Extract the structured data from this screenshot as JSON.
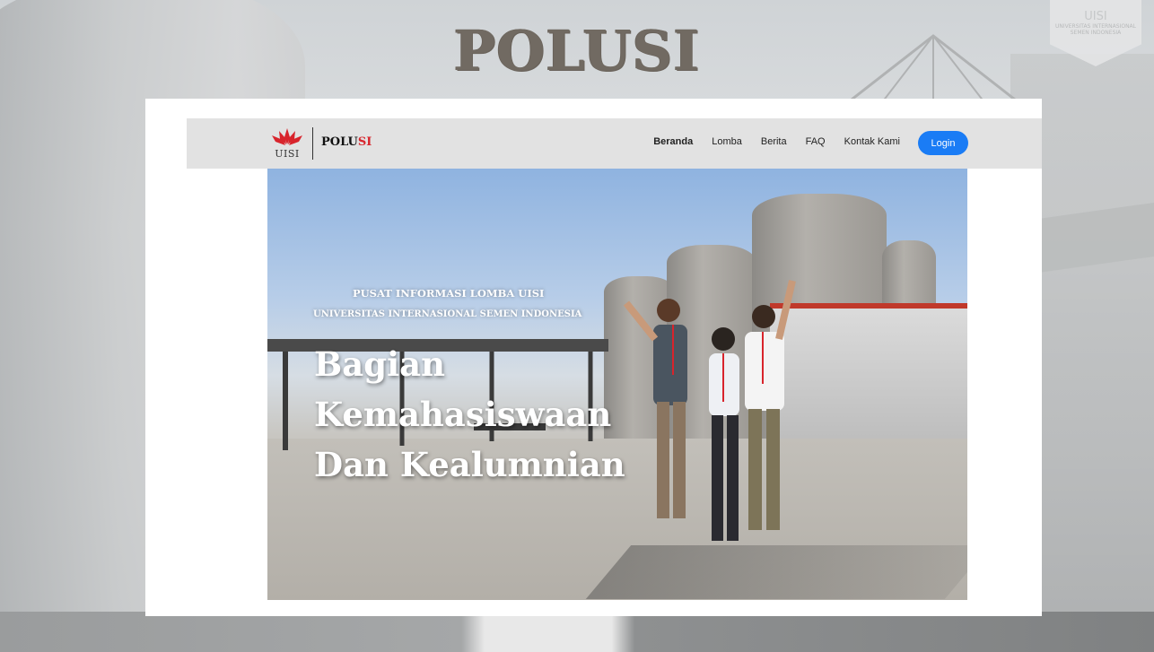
{
  "slide": {
    "title": "POLUSI",
    "badge_lines": [
      "UISI",
      "UNIVERSITAS INTERNASIONAL",
      "SEMEN INDONESIA"
    ]
  },
  "site": {
    "logo_text": "UISI",
    "brand_main": "POLU",
    "brand_accent": "SI",
    "nav": [
      {
        "label": "Beranda",
        "active": true
      },
      {
        "label": "Lomba",
        "active": false
      },
      {
        "label": "Berita",
        "active": false
      },
      {
        "label": "FAQ",
        "active": false
      },
      {
        "label": "Kontak Kami",
        "active": false
      }
    ],
    "login_label": "Login",
    "login_color": "#1a7cf5",
    "accent_color": "#d8242c"
  },
  "hero": {
    "kicker": "PUSAT INFORMASI LOMBA UISI",
    "subtitle": "UNIVERSITAS INTERNASIONAL SEMEN INDONESIA",
    "heading_lines": [
      "Bagian",
      "Kemahasiswaan",
      "Dan Kealumnian"
    ]
  }
}
